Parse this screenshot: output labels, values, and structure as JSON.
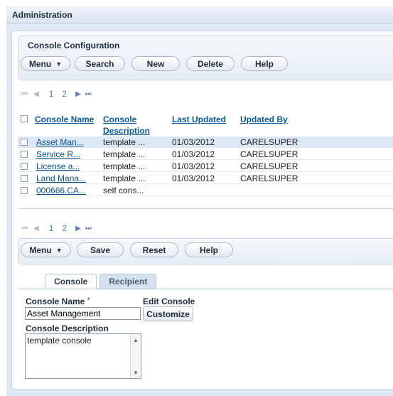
{
  "header": {
    "title": "Administration"
  },
  "section": {
    "title": "Console Configuration"
  },
  "toolbar_top": {
    "menu": "Menu",
    "search": "Search",
    "new": "New",
    "delete": "Delete",
    "help": "Help"
  },
  "pager_top": {
    "pages": [
      "1",
      "2"
    ]
  },
  "pager_bottom": {
    "pages": [
      "1",
      "2"
    ]
  },
  "table": {
    "headers": {
      "name": "Console Name",
      "description_line1": "Console",
      "description_line2": "Description",
      "last_updated": "Last Updated",
      "updated_by": "Updated By"
    },
    "rows": [
      {
        "name": "Asset Man...",
        "description": "template ...",
        "last_updated": "01/03/2012",
        "updated_by": "CARELSUPER"
      },
      {
        "name": "Service R...",
        "description": "template ...",
        "last_updated": "01/03/2012",
        "updated_by": "CARELSUPER"
      },
      {
        "name": "License a...",
        "description": "template ...",
        "last_updated": "01/03/2012",
        "updated_by": "CARELSUPER"
      },
      {
        "name": "Land Mana...",
        "description": "template ...",
        "last_updated": "01/03/2012",
        "updated_by": "CARELSUPER"
      },
      {
        "name": "000666.CA...",
        "description": "self cons...",
        "last_updated": "",
        "updated_by": ""
      }
    ]
  },
  "toolbar_bottom": {
    "menu": "Menu",
    "save": "Save",
    "reset": "Reset",
    "help": "Help"
  },
  "tabs": {
    "console": "Console",
    "recipient": "Recipient"
  },
  "form": {
    "name_label": "Console Name",
    "required_mark": "*",
    "name_value": "Asset Management",
    "edit_label": "Edit Console",
    "customize": "Customize",
    "description_label": "Console Description",
    "description_value": "template console"
  }
}
